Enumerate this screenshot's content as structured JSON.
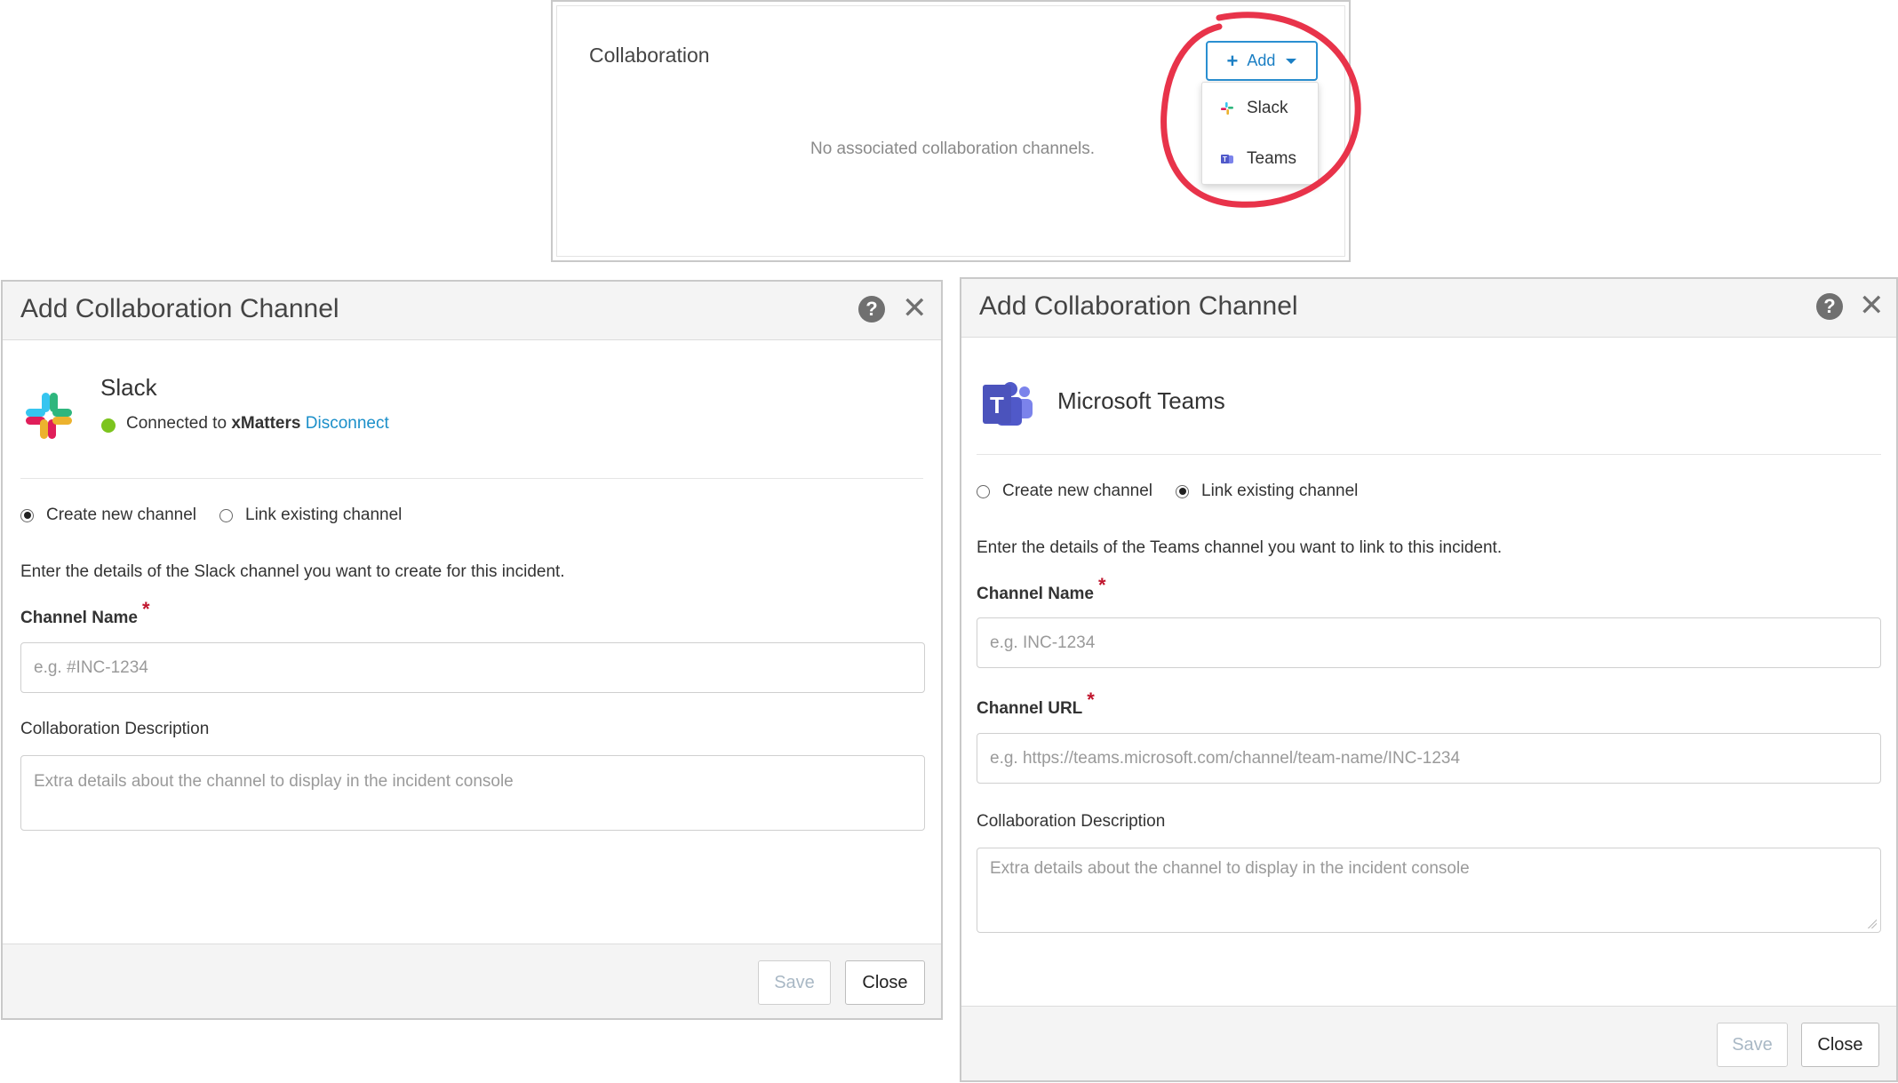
{
  "collaboration_panel": {
    "title": "Collaboration",
    "empty_message": "No associated collaboration channels.",
    "add_button_label": "Add",
    "menu_items": [
      {
        "label": "Slack",
        "icon": "slack-icon"
      },
      {
        "label": "Teams",
        "icon": "teams-icon"
      }
    ],
    "highlight_color": "#e8334a"
  },
  "slack_dialog": {
    "title": "Add Collaboration Channel",
    "app_name": "Slack",
    "status_prefix": "Connected to",
    "status_account": "xMatters",
    "disconnect_label": "Disconnect",
    "radio_options": [
      {
        "label": "Create new channel",
        "checked": true
      },
      {
        "label": "Link existing channel",
        "checked": false
      }
    ],
    "instructions": "Enter the details of the Slack channel you want to create for this incident.",
    "channel_name_label": "Channel Name",
    "channel_name_placeholder": "e.g. #INC-1234",
    "description_label": "Collaboration Description",
    "description_placeholder": "Extra details about the channel to display in the incident console",
    "save_label": "Save",
    "close_label": "Close"
  },
  "teams_dialog": {
    "title": "Add Collaboration Channel",
    "app_name": "Microsoft Teams",
    "radio_options": [
      {
        "label": "Create new channel",
        "checked": false
      },
      {
        "label": "Link existing channel",
        "checked": true
      }
    ],
    "instructions": "Enter the details of the Teams channel you want to link to this incident.",
    "channel_name_label": "Channel Name",
    "channel_name_placeholder": "e.g. INC-1234",
    "channel_url_label": "Channel URL",
    "channel_url_placeholder": "e.g. https://teams.microsoft.com/channel/team-name/INC-1234",
    "description_label": "Collaboration Description",
    "description_placeholder": "Extra details about the channel to display in the incident console",
    "save_label": "Save",
    "close_label": "Close"
  },
  "colors": {
    "accent_blue": "#1b7fc4",
    "required_red": "#c0152d",
    "status_green": "#7cc41e",
    "teams_purple": "#5059c9"
  }
}
